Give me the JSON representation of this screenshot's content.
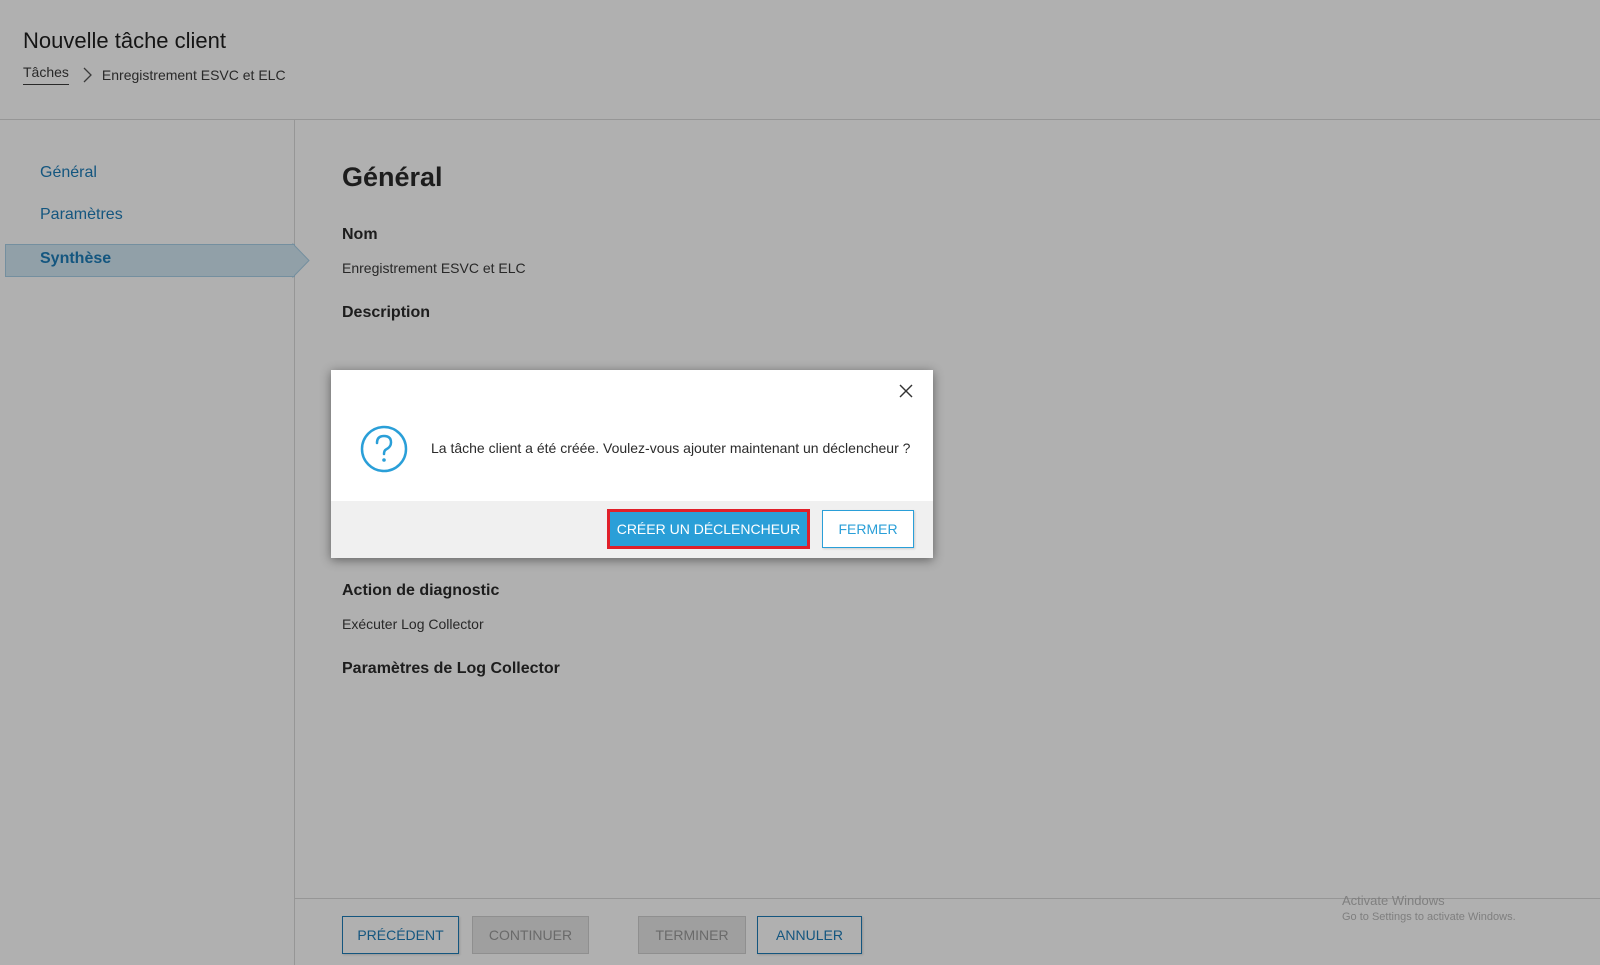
{
  "header": {
    "title": "Nouvelle tâche client",
    "breadcrumb": {
      "link": "Tâches",
      "current": "Enregistrement ESVC et ELC"
    }
  },
  "sidebar": {
    "items": [
      {
        "label": "Général"
      },
      {
        "label": "Paramètres"
      },
      {
        "label": "Synthèse",
        "active": true
      }
    ]
  },
  "main": {
    "section_title": "Général",
    "fields": {
      "name_label": "Nom",
      "name_value": "Enregistrement ESVC et ELC",
      "description_label": "Description",
      "diagnostic_label": "Action de diagnostic",
      "diagnostic_value": "Exécuter Log Collector",
      "log_params_label": "Paramètres de Log Collector"
    }
  },
  "footer": {
    "previous_label": "PRÉCÉDENT",
    "continue_label": "CONTINUER",
    "finish_label": "TERMINER",
    "cancel_label": "ANNULER"
  },
  "watermark": {
    "line1": "Activate Windows",
    "line2": "Go to Settings to activate Windows."
  },
  "dialog": {
    "message": "La tâche client a été créée. Voulez-vous ajouter maintenant un déclencheur ?",
    "create_trigger_label": "CRÉER UN DÉCLENCHEUR",
    "close_label": "FERMER",
    "icon": "question-circle-icon"
  },
  "colors": {
    "accent": "#1e7db9",
    "primary_button": "#2a9fd8",
    "highlight_border": "#e0202a",
    "overlay": "rgba(0,0,0,0.31)"
  }
}
